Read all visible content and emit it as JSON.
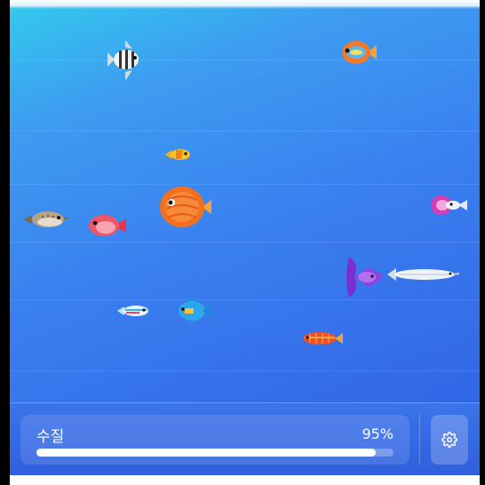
{
  "status": {
    "quality_label": "수질",
    "quality_value": "95%",
    "quality_fraction": 0.95
  },
  "controls": {
    "settings_icon": "gear-icon"
  },
  "fish": [
    "striped-angelfish",
    "orange-blue-fish",
    "small-yellow-fish",
    "orange-discus",
    "pufferfish",
    "pink-fish",
    "pink-white-fish",
    "purple-betta",
    "needlefish",
    "neon-tetra",
    "blue-fish",
    "orange-striped-fish"
  ]
}
